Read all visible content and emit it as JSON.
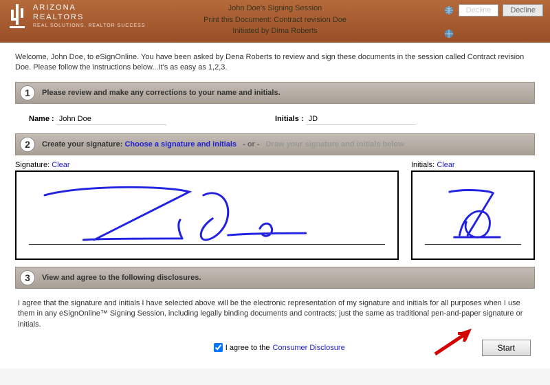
{
  "header": {
    "brand_line1": "ARIZONA",
    "brand_line2": "REALTORS",
    "brand_sub": "REAL SOLUTIONS. REALTOR SUCCESS",
    "session_title": "John Doe's Signing Session",
    "print_line": "Print this Document:  Contract revision Doe",
    "initiated_by": "Initiated by Dima Roberts",
    "decline_ghost": "Decline",
    "decline": "Decline"
  },
  "welcome": "Welcome, John Doe, to eSignOnline. You have been asked by Dena Roberts to review and sign these documents in the session called Contract revision Doe. Please follow the instructions below...It's as easy as 1,2,3.",
  "step1": {
    "num": "1",
    "title": "Please review and make any corrections to your name and initials.",
    "name_label": "Name :",
    "name_value": "John Doe",
    "initials_label": "Initials :",
    "initials_value": "JD"
  },
  "step2": {
    "num": "2",
    "title_a": "Create your signature:",
    "link": "Choose a signature and initials",
    "sep": "- or -",
    "muted": "Draw your signature and initials below",
    "sig_label": "Signature:",
    "init_label": "Initials:",
    "clear": "Clear"
  },
  "step3": {
    "num": "3",
    "title": "View and agree to the following disclosures.",
    "text": "I agree that the signature and initials I have selected above will be the electronic representation of my signature and initials for all purposes when I use them in any eSignOnline™ Signing Session, including legally binding documents and contracts; just the same as traditional pen-and-paper signature or initials."
  },
  "footer": {
    "agree_a": "I agree to the",
    "agree_link": "Consumer Disclosure",
    "start": "Start"
  }
}
